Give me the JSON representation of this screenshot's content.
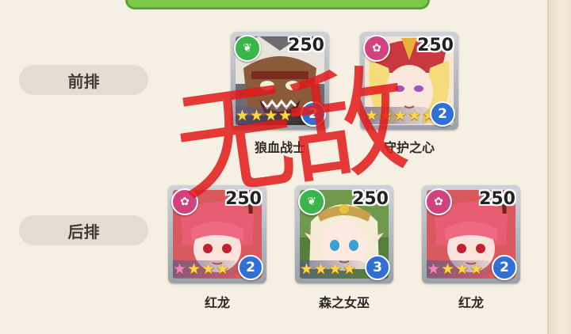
{
  "rows": {
    "front_label": "前排",
    "back_label": "后排"
  },
  "cards": [
    {
      "name": "狼血战士",
      "power": "250",
      "stars": 4,
      "level": "2",
      "faction": "forest",
      "faction_icon": "leaf-icon",
      "faction_color": "#39b54a",
      "portrait": "werewolf"
    },
    {
      "name": "守护之心",
      "power": "250",
      "stars": 5,
      "level": "2",
      "faction": "light",
      "faction_icon": "lotus-icon",
      "faction_color": "#d0437f",
      "portrait": "knight"
    },
    {
      "name": "红龙",
      "power": "250",
      "stars": 4,
      "level": "2",
      "faction": "light",
      "faction_icon": "lotus-icon",
      "faction_color": "#d0437f",
      "portrait": "dragon-girl"
    },
    {
      "name": "森之女巫",
      "power": "250",
      "stars": 4,
      "level": "3",
      "faction": "forest",
      "faction_icon": "leaf-icon",
      "faction_color": "#39b54a",
      "portrait": "elf"
    },
    {
      "name": "红龙",
      "power": "250",
      "stars": 4,
      "level": "2",
      "faction": "light",
      "faction_icon": "lotus-icon",
      "faction_color": "#d0437f",
      "portrait": "dragon-girl"
    }
  ],
  "stamp": "无敌"
}
